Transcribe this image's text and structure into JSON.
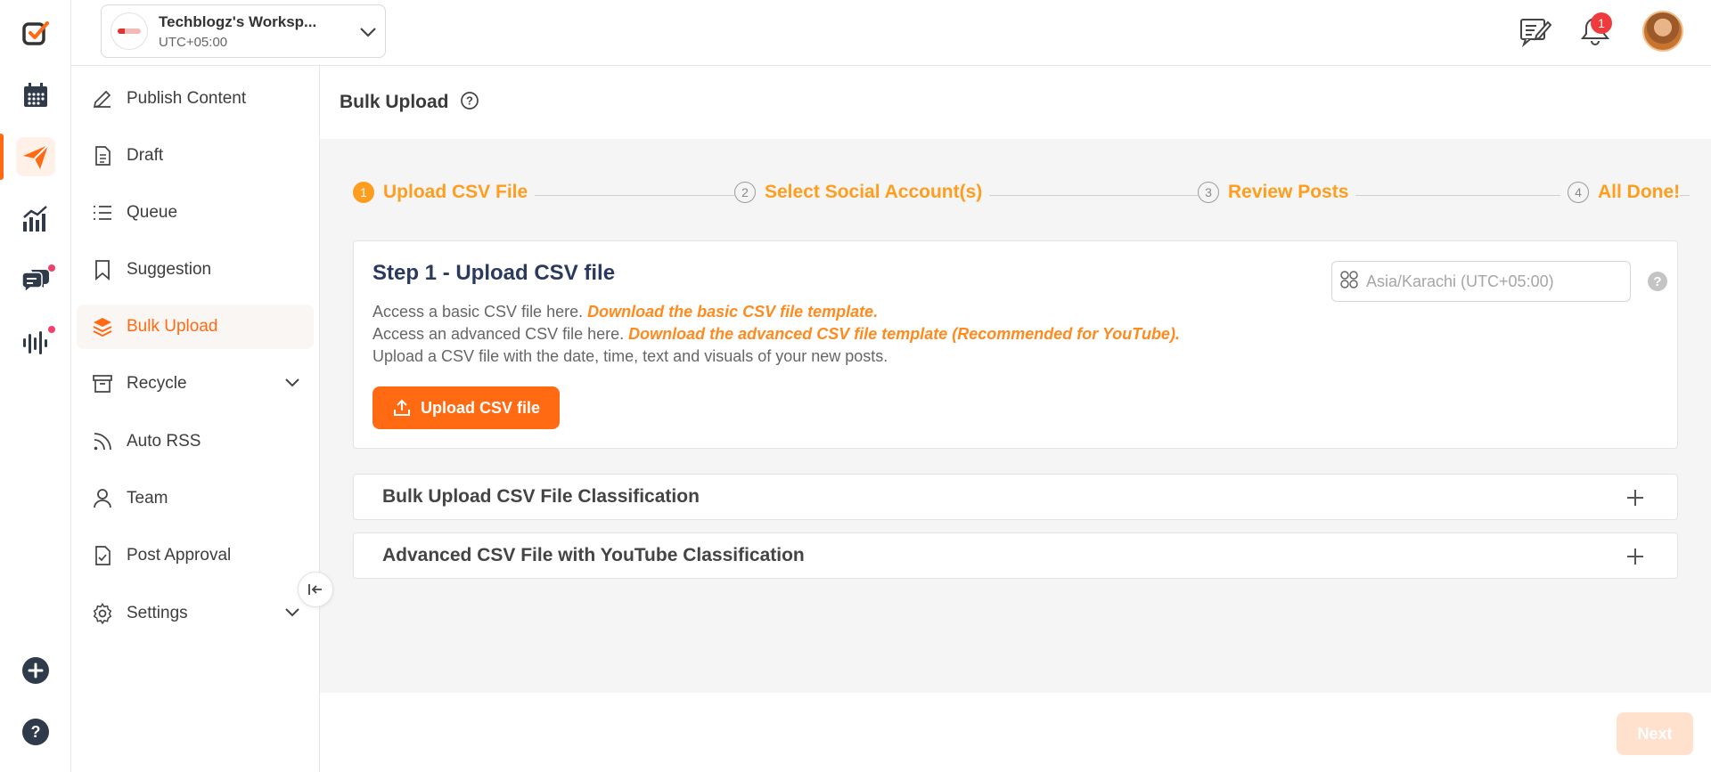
{
  "workspace": {
    "name": "Techblogz's Worksp...",
    "timezone": "UTC+05:00"
  },
  "header": {
    "notification_count": "1"
  },
  "rail": {
    "items": [
      "check-logo-icon",
      "calendar-icon",
      "send-icon",
      "analytics-icon",
      "chat-icon",
      "audio-wave-icon",
      "add-icon",
      "help-icon"
    ]
  },
  "sidebar": {
    "items": [
      {
        "label": "Publish Content",
        "icon": "pencil-icon"
      },
      {
        "label": "Draft",
        "icon": "document-icon"
      },
      {
        "label": "Queue",
        "icon": "list-icon"
      },
      {
        "label": "Suggestion",
        "icon": "bookmark-icon"
      },
      {
        "label": "Bulk Upload",
        "icon": "layers-icon"
      },
      {
        "label": "Recycle",
        "icon": "archive-icon"
      },
      {
        "label": "Auto RSS",
        "icon": "rss-icon"
      },
      {
        "label": "Team",
        "icon": "user-icon"
      },
      {
        "label": "Post Approval",
        "icon": "file-check-icon"
      },
      {
        "label": "Settings",
        "icon": "gear-icon"
      }
    ]
  },
  "page": {
    "title": "Bulk Upload"
  },
  "stepper": {
    "steps": [
      {
        "num": "1",
        "label": "Upload CSV File"
      },
      {
        "num": "2",
        "label": "Select Social Account(s)"
      },
      {
        "num": "3",
        "label": "Review Posts"
      },
      {
        "num": "4",
        "label": "All Done!"
      }
    ]
  },
  "card": {
    "title": "Step 1 - Upload CSV file",
    "timezone_placeholder": "Asia/Karachi (UTC+05:00)",
    "line1_text": "Access a basic CSV file here.",
    "line1_link": "Download the basic CSV file template.",
    "line2_text": "Access an advanced CSV file here.",
    "line2_link": "Download the advanced CSV file template (Recommended for YouTube).",
    "line3_text": "Upload a CSV file with the date, time, text and visuals of your new posts.",
    "upload_button": "Upload CSV file"
  },
  "accordions": [
    {
      "title": "Bulk Upload CSV File Classification"
    },
    {
      "title": "Advanced CSV File with YouTube Classification"
    }
  ],
  "footer": {
    "next_label": "Next"
  },
  "colors": {
    "accent": "#ff6a13",
    "step": "#ff9d1e",
    "title_navy": "#2a3a5e"
  }
}
